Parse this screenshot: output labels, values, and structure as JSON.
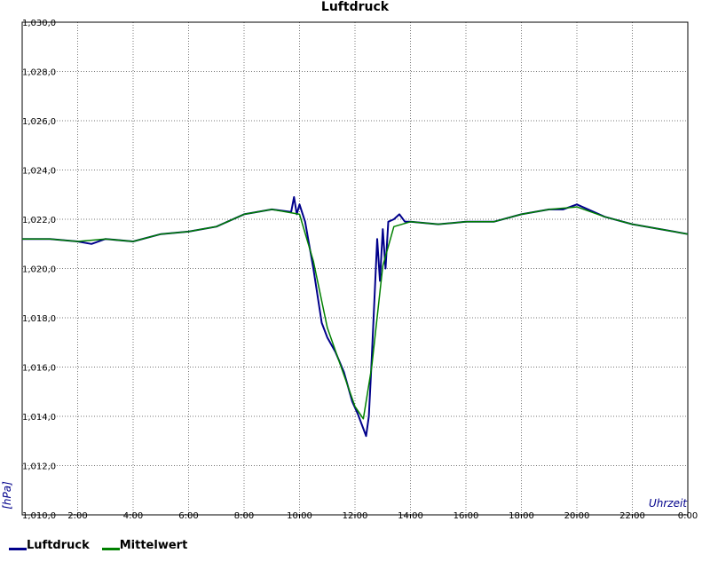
{
  "chart_data": {
    "type": "line",
    "title": "Luftdruck",
    "ylabel": "[hPa]",
    "xlabel": "Uhrzeit",
    "xlim": [
      0,
      24
    ],
    "ylim": [
      1010,
      1030
    ],
    "y_ticks": [
      1010,
      1012,
      1014,
      1016,
      1018,
      1020,
      1022,
      1024,
      1026,
      1028,
      1030
    ],
    "y_tick_labels": [
      "1,010,0",
      "1,012,0",
      "1,014,0",
      "1,016,0",
      "1,018,0",
      "1,020,0",
      "1,022,0",
      "1,024,0",
      "1,026,0",
      "1,028,0",
      "1,030,0"
    ],
    "x_ticks": [
      2,
      4,
      6,
      8,
      10,
      12,
      14,
      16,
      18,
      20,
      22,
      24
    ],
    "x_tick_labels": [
      "2:00",
      "4:00",
      "6:00",
      "8:00",
      "10:00",
      "12:00",
      "14:00",
      "16:00",
      "18:00",
      "20:00",
      "22:00",
      "0:00"
    ],
    "grid": true,
    "legend_position": "bottom-left",
    "series": [
      {
        "name": "Luftdruck",
        "color": "#00008b",
        "x": [
          0,
          1,
          2,
          2.5,
          3,
          4,
          5,
          6,
          7,
          8,
          9,
          9.7,
          9.8,
          9.9,
          10.0,
          10.2,
          10.5,
          10.8,
          11.0,
          11.3,
          11.6,
          11.9,
          12.1,
          12.3,
          12.4,
          12.5,
          12.6,
          12.8,
          12.9,
          13.0,
          13.1,
          13.2,
          13.4,
          13.6,
          13.8,
          14,
          15,
          16,
          17,
          18,
          19,
          19.5,
          20,
          21,
          22,
          23,
          24
        ],
        "values": [
          1021.2,
          1021.2,
          1021.1,
          1021.0,
          1021.2,
          1021.1,
          1021.4,
          1021.5,
          1021.7,
          1022.2,
          1022.4,
          1022.3,
          1022.9,
          1022.2,
          1022.6,
          1021.9,
          1020.0,
          1017.8,
          1017.2,
          1016.6,
          1015.8,
          1014.6,
          1014.1,
          1013.5,
          1013.2,
          1014.0,
          1016.3,
          1021.2,
          1019.5,
          1021.6,
          1020.0,
          1021.9,
          1022.0,
          1022.2,
          1021.9,
          1021.9,
          1021.8,
          1021.9,
          1021.9,
          1022.2,
          1022.4,
          1022.4,
          1022.6,
          1022.1,
          1021.8,
          1021.6,
          1021.4
        ]
      },
      {
        "name": "Mittelwert",
        "color": "#008000",
        "x": [
          0,
          1,
          2,
          3,
          4,
          5,
          6,
          7,
          8,
          9,
          10,
          10.5,
          11,
          11.5,
          12,
          12.3,
          12.6,
          13.0,
          13.4,
          14,
          15,
          16,
          17,
          18,
          19,
          20,
          21,
          22,
          23,
          24
        ],
        "values": [
          1021.2,
          1021.2,
          1021.1,
          1021.2,
          1021.1,
          1021.4,
          1021.5,
          1021.7,
          1022.2,
          1022.4,
          1022.2,
          1020.3,
          1017.6,
          1016.0,
          1014.4,
          1013.9,
          1016.0,
          1020.1,
          1021.7,
          1021.9,
          1021.8,
          1021.9,
          1021.9,
          1022.2,
          1022.4,
          1022.5,
          1022.1,
          1021.8,
          1021.6,
          1021.4
        ]
      }
    ]
  }
}
